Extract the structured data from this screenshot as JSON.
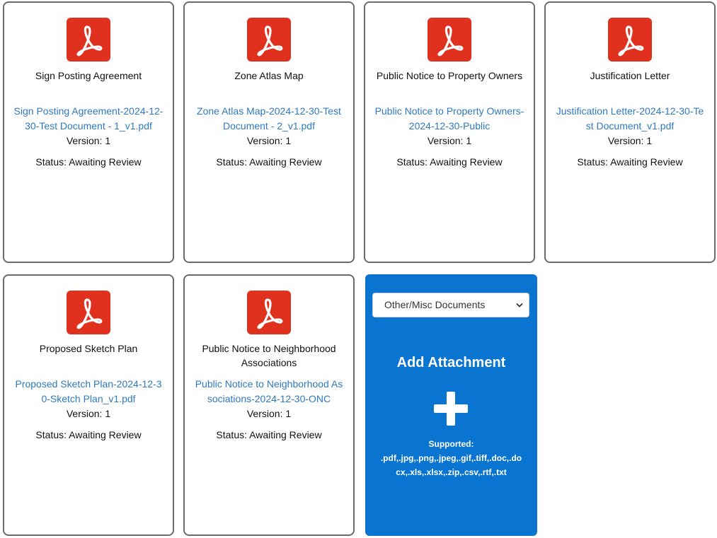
{
  "documents": [
    {
      "title": "Sign Posting Agreement",
      "file_link": "Sign Posting Agreement-2024-12-30-Test Document - 1_v1.pdf",
      "version": "Version: 1",
      "status": "Status: Awaiting Review"
    },
    {
      "title": "Zone Atlas Map",
      "file_link": "Zone Atlas Map-2024-12-30-Test Document - 2_v1.pdf",
      "version": "Version: 1",
      "status": "Status: Awaiting Review"
    },
    {
      "title": "Public Notice to Property Owners",
      "file_link": "Public Notice to Property Owners-2024-12-30-Public",
      "version": "Version: 1",
      "status": "Status: Awaiting Review"
    },
    {
      "title": "Justification Letter",
      "file_link": "Justification Letter-2024-12-30-Test Document_v1.pdf",
      "version": "Version: 1",
      "status": "Status: Awaiting Review"
    },
    {
      "title": "Proposed Sketch Plan",
      "file_link": "Proposed Sketch Plan-2024-12-30-Sketch Plan_v1.pdf",
      "version": "Version: 1",
      "status": "Status: Awaiting Review"
    },
    {
      "title": "Public Notice to Neighborhood Associations",
      "file_link": "Public Notice to Neighborhood Associations-2024-12-30-ONC",
      "version": "Version: 1",
      "status": "Status: Awaiting Review"
    }
  ],
  "add_attachment": {
    "category_selected": "Other/Misc Documents",
    "title": "Add Attachment",
    "supported_label": "Supported:",
    "supported_types": ".pdf,.jpg,.png,.jpeg,.gif,.tiff,.doc,.docx,.xls,.xlsx,.zip,.csv,.rtf,.txt"
  },
  "colors": {
    "pdf_red": "#e0301e",
    "link_blue": "#2f7ac0",
    "add_card_blue": "#0a74d1",
    "card_border": "#6b6b6b"
  },
  "icons": {
    "document": "pdf-icon",
    "add": "plus-icon",
    "dropdown": "chevron-down-icon"
  }
}
